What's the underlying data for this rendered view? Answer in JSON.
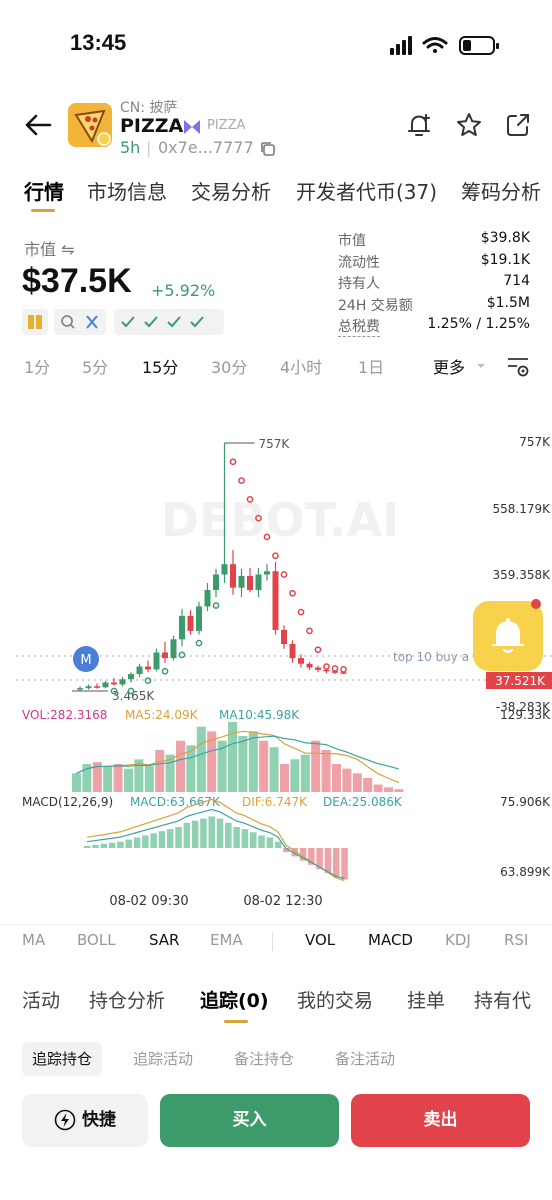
{
  "status": {
    "time": "13:45"
  },
  "token": {
    "cn_name": "CN: 披萨",
    "symbol": "PIZZA",
    "sub_symbol": "PIZZA",
    "age": "5h",
    "address": "0x7e...7777"
  },
  "main_tabs": [
    "行情",
    "市场信息",
    "交易分析",
    "开发者代币(37)",
    "筹码分析"
  ],
  "market": {
    "label": "市值 ⇋",
    "value": "$37.5K",
    "change": "+5.92%",
    "change_color": "#3a9b6b"
  },
  "stats": [
    {
      "key": "市值",
      "value": "$39.8K"
    },
    {
      "key": "流动性",
      "value": "$19.1K"
    },
    {
      "key": "持有人",
      "value": "714"
    },
    {
      "key": "24H 交易额",
      "value": "$1.5M"
    },
    {
      "key": "总税费",
      "value": "1.25% / 1.25%"
    }
  ],
  "intervals": [
    "1分",
    "5分",
    "15分",
    "30分",
    "4小时",
    "1日"
  ],
  "interval_more": "更多",
  "chart_data": {
    "type": "candlestick",
    "price_axis": [
      "757K",
      "558.179K",
      "359.358K"
    ],
    "vol_axis": [
      "129.33K",
      "75.906K",
      "63.899K"
    ],
    "x_labels": [
      "08-02 09:30",
      "08-02 12:30"
    ],
    "high_label": "757K",
    "low_label": "3.465K",
    "current_price": "37.521K",
    "neg_label": "-38.283K",
    "annotation": "top 10 buy a",
    "marker": "M",
    "watermark": "DEBOT.AI",
    "vol_legend": {
      "vol": "VOL:282.3168",
      "ma5": "MA5:24.09K",
      "ma10": "MA10:45.98K"
    },
    "macd_legend": {
      "name": "MACD(12,26,9)",
      "macd": "MACD:63.667K",
      "dif": "DIF:6.747K",
      "dea": "DEA:25.086K"
    },
    "colors": {
      "up": "#3d9a6a",
      "down": "#e2434b",
      "sar": "#e2434b",
      "vol_color": "#d4368a",
      "ma5": "#d9a23a",
      "ma10": "#3aa3a6"
    },
    "candles": [
      {
        "o": 3,
        "h": 10,
        "l": 0,
        "c": 6
      },
      {
        "o": 6,
        "h": 14,
        "l": 3,
        "c": 10
      },
      {
        "o": 10,
        "h": 16,
        "l": 5,
        "c": 8
      },
      {
        "o": 8,
        "h": 22,
        "l": 6,
        "c": 18
      },
      {
        "o": 18,
        "h": 28,
        "l": 12,
        "c": 14
      },
      {
        "o": 14,
        "h": 30,
        "l": 10,
        "c": 25
      },
      {
        "o": 25,
        "h": 40,
        "l": 18,
        "c": 36
      },
      {
        "o": 36,
        "h": 58,
        "l": 30,
        "c": 52
      },
      {
        "o": 52,
        "h": 65,
        "l": 40,
        "c": 46
      },
      {
        "o": 46,
        "h": 90,
        "l": 42,
        "c": 82
      },
      {
        "o": 82,
        "h": 105,
        "l": 60,
        "c": 70
      },
      {
        "o": 70,
        "h": 118,
        "l": 65,
        "c": 110
      },
      {
        "o": 110,
        "h": 175,
        "l": 95,
        "c": 160
      },
      {
        "o": 160,
        "h": 172,
        "l": 120,
        "c": 128
      },
      {
        "o": 128,
        "h": 190,
        "l": 120,
        "c": 180
      },
      {
        "o": 180,
        "h": 230,
        "l": 170,
        "c": 215
      },
      {
        "o": 215,
        "h": 260,
        "l": 200,
        "c": 248
      },
      {
        "o": 248,
        "h": 528,
        "l": 230,
        "c": 270
      },
      {
        "o": 270,
        "h": 300,
        "l": 205,
        "c": 220
      },
      {
        "o": 220,
        "h": 260,
        "l": 200,
        "c": 245
      },
      {
        "o": 245,
        "h": 262,
        "l": 210,
        "c": 215
      },
      {
        "o": 215,
        "h": 262,
        "l": 200,
        "c": 248
      },
      {
        "o": 248,
        "h": 270,
        "l": 235,
        "c": 255
      },
      {
        "o": 255,
        "h": 275,
        "l": 120,
        "c": 130
      },
      {
        "o": 130,
        "h": 140,
        "l": 90,
        "c": 100
      },
      {
        "o": 100,
        "h": 108,
        "l": 60,
        "c": 70
      },
      {
        "o": 70,
        "h": 78,
        "l": 50,
        "c": 58
      },
      {
        "o": 58,
        "h": 62,
        "l": 45,
        "c": 50
      },
      {
        "o": 50,
        "h": 54,
        "l": 40,
        "c": 45
      },
      {
        "o": 45,
        "h": 48,
        "l": 38,
        "c": 42
      },
      {
        "o": 42,
        "h": 44,
        "l": 36,
        "c": 40
      },
      {
        "o": 40,
        "h": 42,
        "l": 36,
        "c": 38
      }
    ],
    "volumes": [
      20,
      30,
      32,
      28,
      30,
      25,
      35,
      28,
      45,
      40,
      55,
      50,
      70,
      65,
      55,
      75,
      60,
      65,
      55,
      48,
      30,
      35,
      40,
      55,
      45,
      30,
      25,
      20,
      15,
      8,
      5,
      3
    ],
    "macd_bars": [
      2,
      3,
      4,
      5,
      6,
      8,
      10,
      12,
      14,
      16,
      18,
      20,
      24,
      26,
      28,
      30,
      28,
      24,
      20,
      18,
      15,
      12,
      10,
      6,
      -4,
      -8,
      -12,
      -16,
      -20,
      -24,
      -28,
      -30
    ]
  },
  "indicators": [
    "MA",
    "BOLL",
    "SAR",
    "EMA",
    "VOL",
    "MACD",
    "KDJ",
    "RSI"
  ],
  "section_tabs": [
    "活动",
    "持仓分析",
    "追踪(0)",
    "我的交易",
    "挂单",
    "持有代"
  ],
  "sub_tabs": [
    "追踪持仓",
    "追踪活动",
    "备注持仓",
    "备注活动"
  ],
  "actions": {
    "quick": "快捷",
    "buy": "买入",
    "sell": "卖出"
  }
}
